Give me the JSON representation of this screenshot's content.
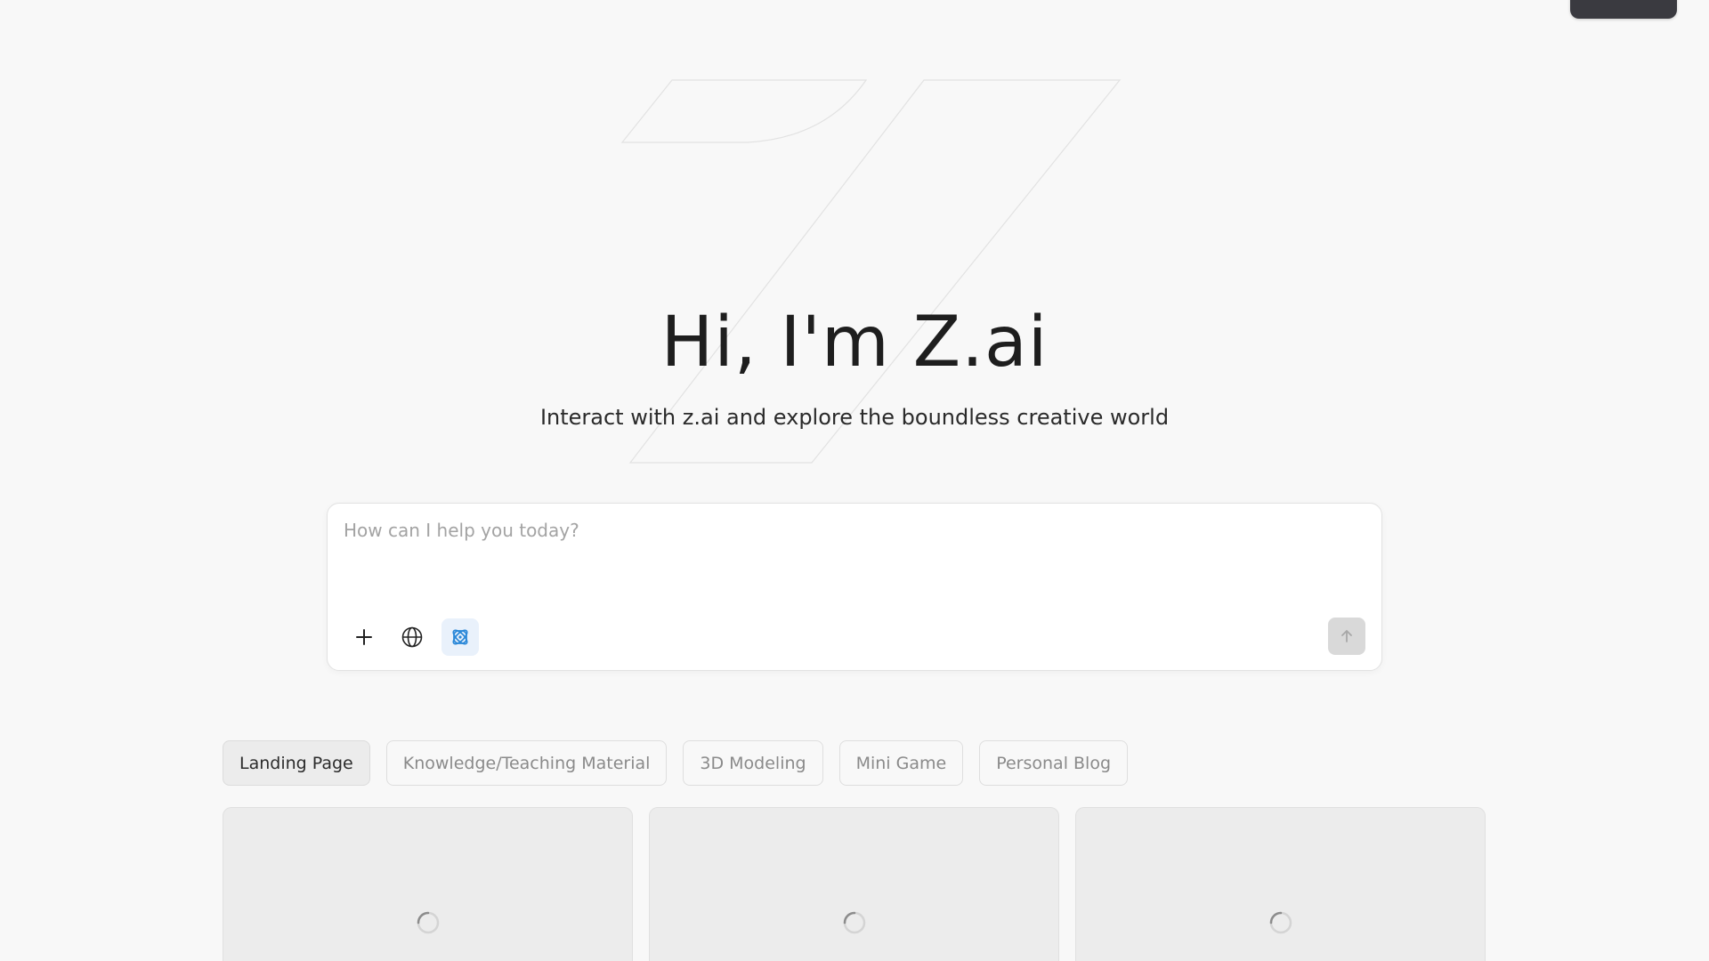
{
  "header": {
    "corner_button_label": ""
  },
  "hero": {
    "title": "Hi, I'm Z.ai",
    "subtitle": "Interact with z.ai and explore the boundless creative world"
  },
  "chat": {
    "placeholder": "How can I help you today?",
    "value": "",
    "tools": [
      {
        "name": "plus-icon",
        "active": false
      },
      {
        "name": "globe-icon",
        "active": false
      },
      {
        "name": "atom-icon",
        "active": true
      }
    ],
    "send_enabled": false
  },
  "categories": [
    {
      "label": "Landing Page",
      "active": true
    },
    {
      "label": "Knowledge/Teaching Material",
      "active": false
    },
    {
      "label": "3D Modeling",
      "active": false
    },
    {
      "label": "Mini Game",
      "active": false
    },
    {
      "label": "Personal Blog",
      "active": false
    }
  ],
  "cards": [
    {
      "state": "loading"
    },
    {
      "state": "loading"
    },
    {
      "state": "loading"
    }
  ],
  "colors": {
    "background": "#f8f8f8",
    "accent": "#2b88d8",
    "dark_button": "#3a3a40",
    "card": "#ececec"
  }
}
